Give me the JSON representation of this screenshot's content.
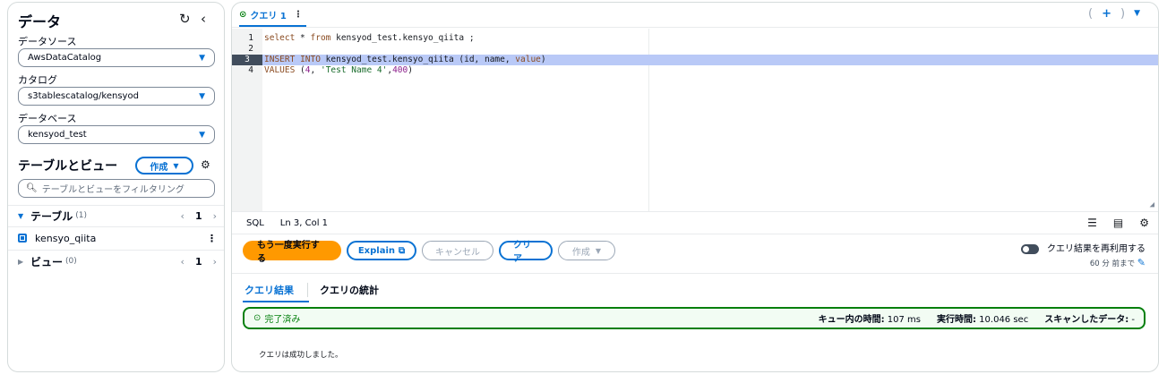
{
  "left": {
    "title": "データ",
    "data_source_label": "データソース",
    "data_source_value": "AwsDataCatalog",
    "catalog_label": "カタログ",
    "catalog_value": "s3tablescatalog/kensyod",
    "database_label": "データベース",
    "database_value": "kensyod_test",
    "tables_views_title": "テーブルとビュー",
    "create_button": "作成",
    "filter_placeholder": "テーブルとビューをフィルタリング",
    "tables_group": {
      "name": "テーブル",
      "count": "(1)",
      "page": "1"
    },
    "table_items": [
      "kensyo_qiita"
    ],
    "views_group": {
      "name": "ビュー",
      "count": "(0)",
      "page": "1"
    }
  },
  "editor": {
    "tab_label": "クエリ 1",
    "lines": [
      {
        "n": "1",
        "segments": [
          {
            "t": "select",
            "c": "kw"
          },
          {
            "t": " * ",
            "c": ""
          },
          {
            "t": "from",
            "c": "kw"
          },
          {
            "t": " kensyod_test.kensyo_qiita ;",
            "c": ""
          }
        ]
      },
      {
        "n": "2",
        "segments": []
      },
      {
        "n": "3",
        "segments": [
          {
            "t": "INSERT",
            "c": "kw"
          },
          {
            "t": " ",
            "c": ""
          },
          {
            "t": "INTO",
            "c": "kw"
          },
          {
            "t": " kensyod_test.kensyo_qiita (id, name, ",
            "c": ""
          },
          {
            "t": "value",
            "c": "kw"
          },
          {
            "t": ")",
            "c": ""
          }
        ]
      },
      {
        "n": "4",
        "segments": [
          {
            "t": "VALUES",
            "c": "kw"
          },
          {
            "t": " (",
            "c": ""
          },
          {
            "t": "4",
            "c": "num"
          },
          {
            "t": ", ",
            "c": ""
          },
          {
            "t": "'Test Name 4'",
            "c": "str"
          },
          {
            "t": ",",
            "c": ""
          },
          {
            "t": "400",
            "c": "num"
          },
          {
            "t": ")",
            "c": ""
          }
        ]
      }
    ],
    "selected_line": "3",
    "status_lang": "SQL",
    "status_pos": "Ln 3, Col 1"
  },
  "actions": {
    "rerun": "もう一度実行する",
    "explain": "Explain",
    "cancel": "キャンセル",
    "clear": "クリア",
    "create": "作成"
  },
  "reuse": {
    "label": "クエリ結果を再利用する",
    "sub": "60 分 前まで"
  },
  "results": {
    "tab_results": "クエリ結果",
    "tab_stats": "クエリの統計",
    "status": "完了済み",
    "queue_label": "キュー内の時間:",
    "queue_value": "107 ms",
    "exec_label": "実行時間:",
    "exec_value": "10.046 sec",
    "scan_label": "スキャンしたデータ:",
    "scan_value": "-",
    "message": "クエリは成功しました。"
  }
}
